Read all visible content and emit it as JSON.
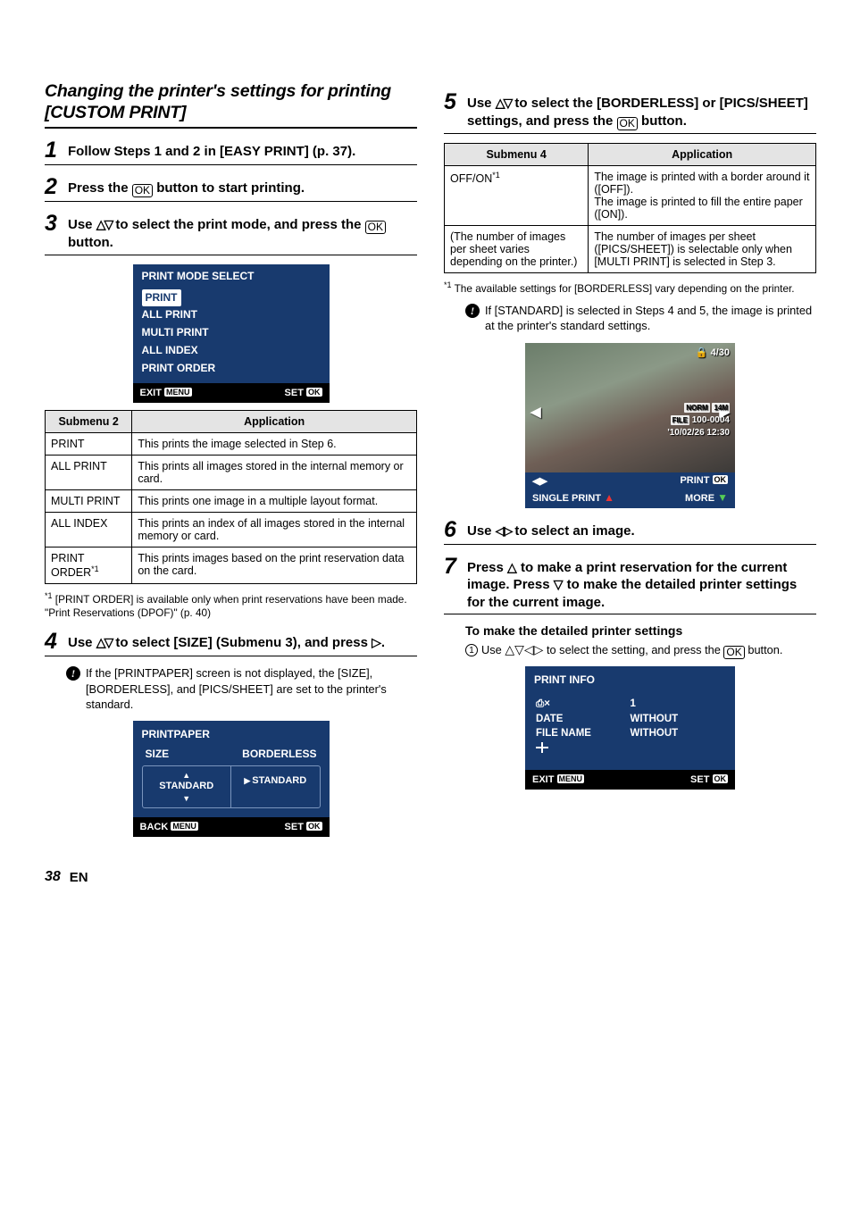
{
  "page_number": "38",
  "lang": "EN",
  "left": {
    "section_title": "Changing the printer's settings for printing [CUSTOM PRINT]",
    "step1_text": "Follow Steps 1 and 2 in [EASY PRINT] (p. 37).",
    "step2_prefix": "Press the ",
    "step2_suffix": " button to start printing.",
    "step3_prefix": "Use ",
    "step3_mid": " to select the print mode, and press the ",
    "step3_suffix": " button.",
    "lcd1": {
      "title": "PRINT MODE SELECT",
      "items": [
        "PRINT",
        "ALL PRINT",
        "MULTI PRINT",
        "ALL INDEX",
        "PRINT ORDER"
      ],
      "exit": "EXIT",
      "set": "SET"
    },
    "table1": {
      "headers": [
        "Submenu 2",
        "Application"
      ],
      "rows": [
        [
          "PRINT",
          "This prints the image selected in Step 6."
        ],
        [
          "ALL PRINT",
          "This prints all images stored in the internal memory or card."
        ],
        [
          "MULTI PRINT",
          "This prints one image in a multiple layout format."
        ],
        [
          "ALL INDEX",
          "This prints an index of all images stored in the internal memory or card."
        ],
        [
          "PRINT ORDER*1",
          "This prints images based on the print reservation data on the card."
        ]
      ]
    },
    "footnote1_label": "*1",
    "footnote1_text": "[PRINT ORDER] is available only when print reservations have been made. \"Print Reservations (DPOF)\" (p. 40)",
    "step4_prefix": "Use ",
    "step4_mid": " to select [SIZE] (Submenu 3), and press ",
    "step4_suffix": ".",
    "note4": "If the [PRINTPAPER] screen is not displayed, the [SIZE], [BORDERLESS], and [PICS/SHEET] are set to the printer's standard.",
    "lcd2": {
      "title": "PRINTPAPER",
      "col1": "SIZE",
      "col2": "BORDERLESS",
      "val": "STANDARD",
      "back": "BACK",
      "set": "SET"
    }
  },
  "right": {
    "step5_prefix": "Use ",
    "step5_mid": " to select the [BORDERLESS] or [PICS/SHEET] settings, and press the ",
    "step5_suffix": " button.",
    "table2": {
      "headers": [
        "Submenu 4",
        "Application"
      ],
      "rows": [
        [
          "OFF/ON*1",
          "The image is printed with a border around it ([OFF]).\nThe image is printed to fill the entire paper ([ON])."
        ],
        [
          "(The number of images per sheet varies depending on the printer.)",
          "The number of images per sheet ([PICS/SHEET]) is selectable only when [MULTI PRINT] is selected in Step 3."
        ]
      ]
    },
    "footnote2_label": "*1",
    "footnote2_text": "The available settings for [BORDERLESS] vary depending on the printer.",
    "note5": "If [STANDARD] is selected in Steps 4 and 5, the image is printed at the printer's standard settings.",
    "photo": {
      "counter": "4/30",
      "norm": "NORM",
      "mp": "14M",
      "file": "100-0004",
      "file_prefix": "FILE",
      "date": "'10/02/26 12:30",
      "dir_label": "◀▶",
      "single": "SINGLE PRINT",
      "print": "PRINT",
      "more": "MORE"
    },
    "step6_prefix": "Use ",
    "step6_suffix": " to select an image.",
    "step7_prefix": "Press ",
    "step7_mid1": " to make a print reservation for the current image. Press ",
    "step7_mid2": " to make the detailed printer settings for the current image.",
    "sub7_heading": "To make the detailed printer settings",
    "sub7_item_prefix": "Use ",
    "sub7_item_mid": " to select the setting, and press the ",
    "sub7_item_suffix": " button.",
    "lcd3": {
      "title": "PRINT INFO",
      "rows": [
        [
          "⎙×",
          "1"
        ],
        [
          "DATE",
          "WITHOUT"
        ],
        [
          "FILE NAME",
          "WITHOUT"
        ]
      ],
      "exit": "EXIT",
      "set": "SET"
    }
  },
  "ok_label": "OK",
  "menu_label": "MENU"
}
